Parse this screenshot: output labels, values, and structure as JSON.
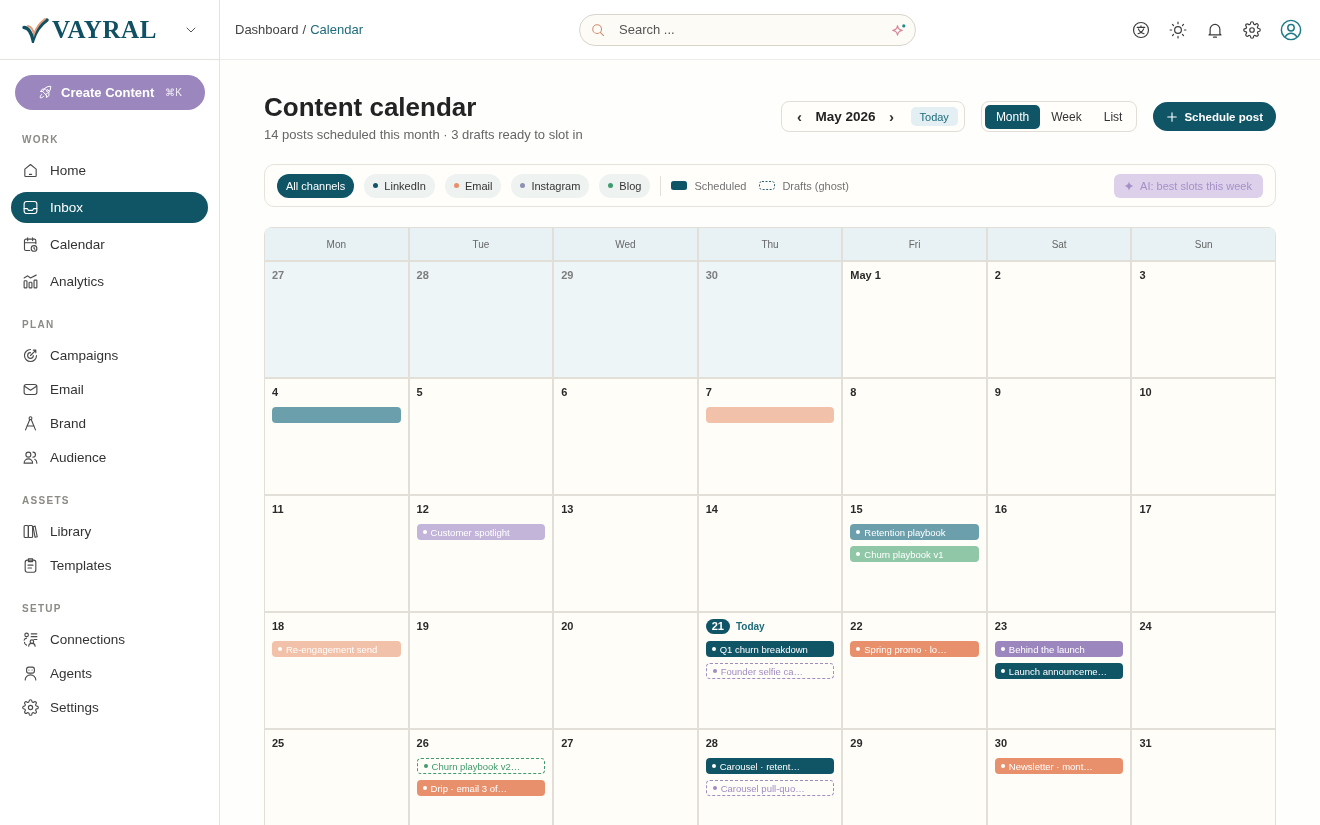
{
  "sidebar": {
    "logo": "VAYRAL",
    "create_button": {
      "label": "Create Content",
      "shortcut": "⌘K"
    },
    "sections": [
      {
        "title": "WORK",
        "items": [
          {
            "label": "Home",
            "selected": false
          },
          {
            "label": "Inbox",
            "selected": true
          },
          {
            "label": "Calendar",
            "selected": false
          },
          {
            "label": "Analytics",
            "selected": false
          }
        ]
      },
      {
        "title": "PLAN",
        "items": [
          {
            "label": "Campaigns",
            "selected": false
          },
          {
            "label": "Email",
            "selected": false
          },
          {
            "label": "Brand",
            "selected": false
          },
          {
            "label": "Audience",
            "selected": false
          }
        ]
      },
      {
        "title": "ASSETS",
        "items": [
          {
            "label": "Library",
            "selected": false
          },
          {
            "label": "Templates",
            "selected": false
          }
        ]
      },
      {
        "title": "SETUP",
        "items": [
          {
            "label": "Connections",
            "selected": false
          },
          {
            "label": "Agents",
            "selected": false
          },
          {
            "label": "Settings",
            "selected": false
          }
        ]
      }
    ]
  },
  "topbar": {
    "breadcrumb": [
      {
        "label": "Dashboard",
        "current": false
      },
      {
        "label": "Calendar",
        "current": true
      }
    ],
    "separator": "/",
    "search": {
      "placeholder": "Search ..."
    }
  },
  "page": {
    "title": "Content calendar",
    "subtitle": "14 posts scheduled this month · 3 drafts ready to slot in"
  },
  "month_nav": {
    "prev": "‹",
    "label": "May 2026",
    "next": "›",
    "today": "Today"
  },
  "views": [
    {
      "label": "Month",
      "selected": true
    },
    {
      "label": "Week",
      "selected": false
    },
    {
      "label": "List",
      "selected": false
    }
  ],
  "schedule_button": {
    "label": "Schedule post"
  },
  "filters": {
    "channels": [
      {
        "label": "All channels",
        "selected": true
      },
      {
        "label": "LinkedIn",
        "selected": false,
        "color": "#0f5566"
      },
      {
        "label": "Email",
        "selected": false,
        "color": "#e8906b"
      },
      {
        "label": "Instagram",
        "selected": false,
        "color": "#8d8fb3"
      },
      {
        "label": "Blog",
        "selected": false,
        "color": "#3f9c6e"
      }
    ],
    "legend": [
      {
        "label": "Scheduled",
        "kind": "solid"
      },
      {
        "label": "Drafts (ghost)",
        "kind": "dashed"
      }
    ],
    "ai_button": {
      "label": "AI: best slots this week",
      "disabled": true
    }
  },
  "calendar": {
    "weekdays": [
      "Mon",
      "Tue",
      "Wed",
      "Thu",
      "Fri",
      "Sat",
      "Sun"
    ],
    "today_label": "Today",
    "days": [
      {
        "date": "27",
        "outside": true,
        "today": false
      },
      {
        "date": "28",
        "outside": true,
        "today": false
      },
      {
        "date": "29",
        "outside": true,
        "today": false
      },
      {
        "date": "30",
        "outside": true,
        "today": false
      },
      {
        "date": "May 1",
        "outside": false,
        "today": false
      },
      {
        "date": "2",
        "outside": false,
        "today": false
      },
      {
        "date": "3",
        "outside": false,
        "today": false
      },
      {
        "date": "4",
        "outside": false,
        "today": false,
        "events": [
          {
            "kind": "scheduled",
            "color": "#6b9fac"
          }
        ]
      },
      {
        "date": "5",
        "outside": false,
        "today": false
      },
      {
        "date": "6",
        "outside": false,
        "today": false
      },
      {
        "date": "7",
        "outside": false,
        "today": false,
        "events": [
          {
            "kind": "scheduled",
            "color": "#f2c1a9"
          }
        ]
      },
      {
        "date": "8",
        "outside": false,
        "today": false
      },
      {
        "date": "9",
        "outside": false,
        "today": false
      },
      {
        "date": "10",
        "outside": false,
        "today": false
      },
      {
        "date": "11",
        "outside": false,
        "today": false
      },
      {
        "date": "12",
        "outside": false,
        "today": false,
        "events": [
          {
            "title": "Customer spotlight",
            "kind": "scheduled",
            "color": "#c2b5d9"
          }
        ]
      },
      {
        "date": "13",
        "outside": false,
        "today": false
      },
      {
        "date": "14",
        "outside": false,
        "today": false
      },
      {
        "date": "15",
        "outside": false,
        "today": false,
        "events": [
          {
            "title": "Retention playbook",
            "kind": "scheduled",
            "color": "#6b9fac"
          },
          {
            "title": "Churn playbook v1",
            "kind": "scheduled",
            "color": "#8fc7a7"
          }
        ]
      },
      {
        "date": "16",
        "outside": false,
        "today": false
      },
      {
        "date": "17",
        "outside": false,
        "today": false
      },
      {
        "date": "18",
        "outside": false,
        "today": false,
        "events": [
          {
            "title": "Re-engagement send",
            "kind": "scheduled",
            "color": "#f2c1a9"
          }
        ]
      },
      {
        "date": "19",
        "outside": false,
        "today": false
      },
      {
        "date": "20",
        "outside": false,
        "today": false
      },
      {
        "date": "21",
        "outside": false,
        "today": true,
        "events": [
          {
            "title": "Q1 churn breakdown",
            "kind": "scheduled",
            "color": "#0f5566"
          },
          {
            "title": "Founder selfie ca…",
            "kind": "draft",
            "color": "#a08cc3"
          }
        ]
      },
      {
        "date": "22",
        "outside": false,
        "today": false,
        "events": [
          {
            "title": "Spring promo · lo…",
            "kind": "scheduled",
            "color": "#e8906b"
          }
        ]
      },
      {
        "date": "23",
        "outside": false,
        "today": false,
        "events": [
          {
            "title": "Behind the launch",
            "kind": "scheduled",
            "color": "#9b87bd"
          },
          {
            "title": "Launch announceme…",
            "kind": "scheduled",
            "color": "#0f5566"
          }
        ]
      },
      {
        "date": "24",
        "outside": false,
        "today": false
      },
      {
        "date": "25",
        "outside": false,
        "today": false
      },
      {
        "date": "26",
        "outside": false,
        "today": false,
        "events": [
          {
            "title": "Churn playbook v2…",
            "kind": "draft",
            "color": "#3f9a6c"
          },
          {
            "title": "Drip · email 3 of…",
            "kind": "scheduled",
            "color": "#e8906b"
          }
        ]
      },
      {
        "date": "27",
        "outside": false,
        "today": false
      },
      {
        "date": "28",
        "outside": false,
        "today": false,
        "events": [
          {
            "title": "Carousel · retent…",
            "kind": "scheduled",
            "color": "#0f5566"
          },
          {
            "title": "Carousel pull-quo…",
            "kind": "draft",
            "color": "#a08cc3"
          }
        ]
      },
      {
        "date": "29",
        "outside": false,
        "today": false
      },
      {
        "date": "30",
        "outside": false,
        "today": false,
        "events": [
          {
            "title": "Newsletter · mont…",
            "kind": "scheduled",
            "color": "#e8906b"
          }
        ]
      },
      {
        "date": "31",
        "outside": false,
        "today": false
      }
    ]
  }
}
